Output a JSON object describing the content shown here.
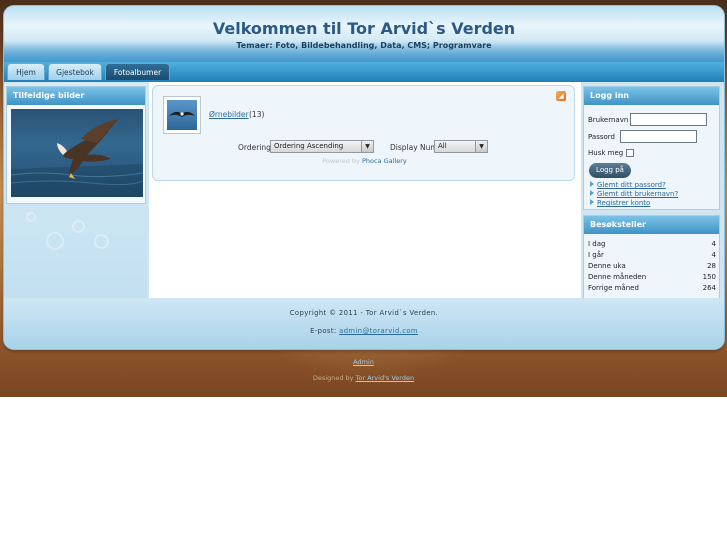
{
  "header": {
    "title": "Velkommen til Tor Arvid`s Verden",
    "subtitle": "Temaer: Foto, Bildebehandling, Data, CMS; Programvare"
  },
  "nav": {
    "tabs": [
      {
        "label": "Hjem"
      },
      {
        "label": "Gjestebok"
      },
      {
        "label": "Fotoalbumer"
      }
    ]
  },
  "left": {
    "random_title": "Tilfeldige bilder"
  },
  "gallery": {
    "category_link": "Ørnebilder",
    "category_count": "(13)",
    "ordering_label": "Ordering",
    "ordering_value": "Ordering Ascending",
    "display_label": "Display Num",
    "display_value": "All",
    "powered_prefix": "Powered by",
    "powered_link": "Phoca Gallery"
  },
  "login": {
    "title": "Logg inn",
    "username_label": "Brukernavn",
    "password_label": "Passord",
    "remember_label": "Husk meg",
    "button": "Logg på",
    "links": [
      "Glemt ditt passord?",
      "Glemt ditt brukernavn?",
      "Registrer konto"
    ]
  },
  "stats": {
    "title": "Besøksteller",
    "rows": [
      {
        "label": "I dag",
        "value": "4"
      },
      {
        "label": "I går",
        "value": "4"
      },
      {
        "label": "Denne uka",
        "value": "28"
      },
      {
        "label": "Denne måneden",
        "value": "150"
      },
      {
        "label": "Forrige måned",
        "value": "264"
      }
    ]
  },
  "footer": {
    "copyright": "Copyright © 2011 - Tor Arvid`s Verden.",
    "email_prefix": "E-post:",
    "email": "admin@torarvid.com",
    "admin_link": "Admin",
    "designed_prefix": "Designed by",
    "designed_link": "Tor Arvid's Verden"
  }
}
